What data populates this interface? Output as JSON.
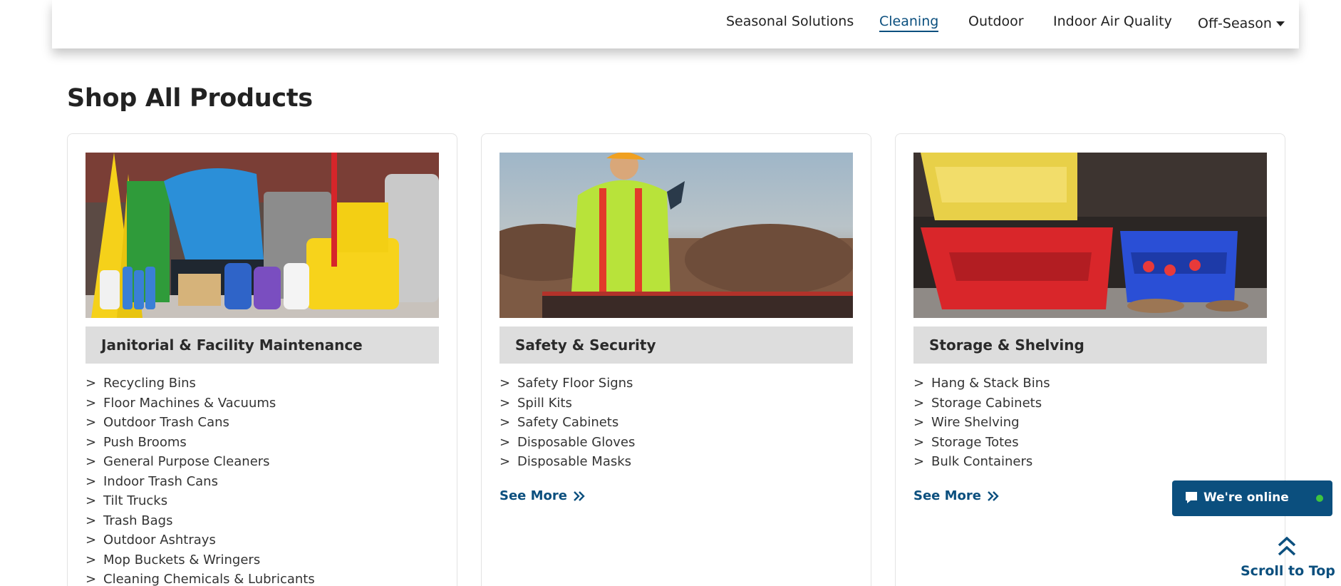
{
  "nav": {
    "items": [
      {
        "label": "Seasonal Solutions",
        "active": false
      },
      {
        "label": "Cleaning",
        "active": true
      },
      {
        "label": "Outdoor",
        "active": false
      },
      {
        "label": "Indoor Air Quality",
        "active": false
      },
      {
        "label": "Off-Season",
        "active": false,
        "has_dropdown": true
      }
    ]
  },
  "page": {
    "title": "Shop All Products"
  },
  "cards": [
    {
      "title": "Janitorial & Facility Maintenance",
      "image": "janitorial-products-photo",
      "items": [
        "Recycling Bins",
        "Floor Machines & Vacuums",
        "Outdoor Trash Cans",
        "Push Brooms",
        "General Purpose Cleaners",
        "Indoor Trash Cans",
        "Tilt Trucks",
        "Trash Bags",
        "Outdoor Ashtrays",
        "Mop Buckets & Wringers",
        "Cleaning Chemicals & Lubricants"
      ],
      "see_more": ""
    },
    {
      "title": "Safety & Security",
      "image": "safety-worker-photo",
      "items": [
        "Safety Floor Signs",
        "Spill Kits",
        "Safety Cabinets",
        "Disposable Gloves",
        "Disposable Masks"
      ],
      "see_more": "See More"
    },
    {
      "title": "Storage & Shelving",
      "image": "storage-bins-photo",
      "items": [
        "Hang & Stack Bins",
        "Storage Cabinets",
        "Wire Shelving",
        "Storage Totes",
        "Bulk Containers"
      ],
      "see_more": "See More"
    }
  ],
  "list_marker": ">",
  "chat": {
    "label": "We're online",
    "status": "online"
  },
  "scroll_top": {
    "label": "Scroll to Top"
  },
  "colors": {
    "accent": "#0b4f7e",
    "card_header_bg": "#dddddd",
    "online": "#3fc43f"
  }
}
